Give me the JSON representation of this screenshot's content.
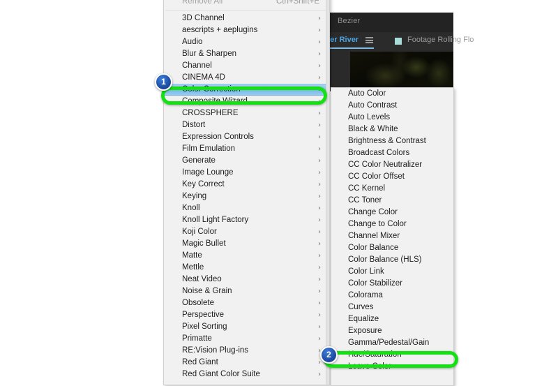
{
  "background": {
    "bezier_label": "Bezier",
    "tab_river_label": "ver River",
    "tab_footage_label": "Footage Rolling Flo",
    "menu_icon_name": "panel-menu-icon"
  },
  "main_menu": {
    "name": "effect-category-menu",
    "header": {
      "label": "Remove All",
      "shortcut": "Ctrl+Shift+E"
    },
    "items": [
      {
        "label": "3D Channel",
        "submenu": true
      },
      {
        "label": "aescripts + aeplugins",
        "submenu": true
      },
      {
        "label": "Audio",
        "submenu": true
      },
      {
        "label": "Blur & Sharpen",
        "submenu": true
      },
      {
        "label": "Channel",
        "submenu": true
      },
      {
        "label": "CINEMA 4D",
        "submenu": true
      },
      {
        "label": "Color Correction",
        "submenu": true,
        "selected": true
      },
      {
        "label": "Composite Wizard",
        "submenu": true
      },
      {
        "label": "CROSSPHERE",
        "submenu": true
      },
      {
        "label": "Distort",
        "submenu": true
      },
      {
        "label": "Expression Controls",
        "submenu": true
      },
      {
        "label": "Film Emulation",
        "submenu": true
      },
      {
        "label": "Generate",
        "submenu": true
      },
      {
        "label": "Image Lounge",
        "submenu": true
      },
      {
        "label": "Key Correct",
        "submenu": true
      },
      {
        "label": "Keying",
        "submenu": true
      },
      {
        "label": "Knoll",
        "submenu": true
      },
      {
        "label": "Knoll Light Factory",
        "submenu": true
      },
      {
        "label": "Koji Color",
        "submenu": true
      },
      {
        "label": "Magic Bullet",
        "submenu": true
      },
      {
        "label": "Matte",
        "submenu": true
      },
      {
        "label": "Mettle",
        "submenu": true
      },
      {
        "label": "Neat Video",
        "submenu": true
      },
      {
        "label": "Noise & Grain",
        "submenu": true
      },
      {
        "label": "Obsolete",
        "submenu": true
      },
      {
        "label": "Perspective",
        "submenu": true
      },
      {
        "label": "Pixel Sorting",
        "submenu": true
      },
      {
        "label": "Primatte",
        "submenu": true
      },
      {
        "label": "RE:Vision Plug-ins",
        "submenu": true
      },
      {
        "label": "Red Giant",
        "submenu": true
      },
      {
        "label": "Red Giant Color Suite",
        "submenu": true
      }
    ]
  },
  "sub_menu": {
    "name": "color-correction-submenu",
    "items": [
      {
        "label": "Auto Color"
      },
      {
        "label": "Auto Contrast"
      },
      {
        "label": "Auto Levels"
      },
      {
        "label": "Black & White"
      },
      {
        "label": "Brightness & Contrast"
      },
      {
        "label": "Broadcast Colors"
      },
      {
        "label": "CC Color Neutralizer"
      },
      {
        "label": "CC Color Offset"
      },
      {
        "label": "CC Kernel"
      },
      {
        "label": "CC Toner"
      },
      {
        "label": "Change Color"
      },
      {
        "label": "Change to Color"
      },
      {
        "label": "Channel Mixer"
      },
      {
        "label": "Color Balance"
      },
      {
        "label": "Color Balance (HLS)"
      },
      {
        "label": "Color Link"
      },
      {
        "label": "Color Stabilizer"
      },
      {
        "label": "Colorama"
      },
      {
        "label": "Curves"
      },
      {
        "label": "Equalize"
      },
      {
        "label": "Exposure"
      },
      {
        "label": "Gamma/Pedestal/Gain"
      },
      {
        "label": "Hue/Saturation",
        "highlighted": true
      },
      {
        "label": "Leave Color"
      }
    ]
  },
  "annotations": {
    "step_1": "1",
    "step_2": "2",
    "highlight_color": "#15e015",
    "badge_color": "#1f4fa8"
  }
}
